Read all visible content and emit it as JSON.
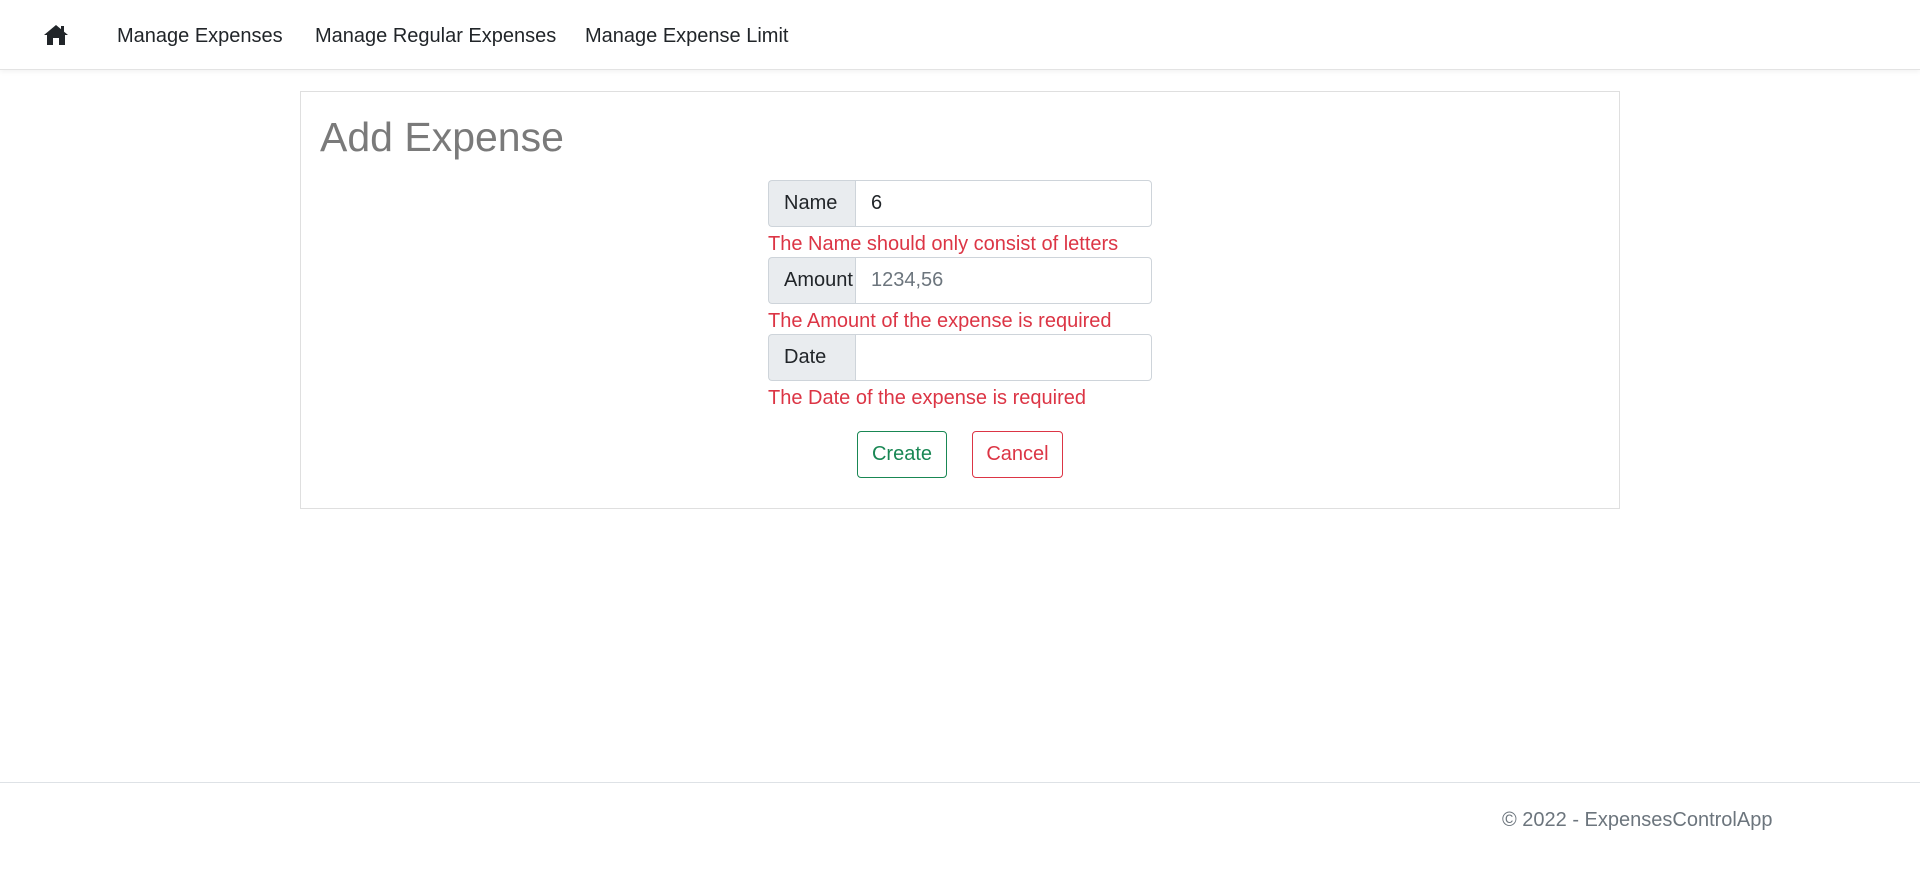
{
  "nav": {
    "home_icon": "home-icon",
    "links": [
      {
        "label": "Manage Expenses"
      },
      {
        "label": "Manage Regular Expenses"
      },
      {
        "label": "Manage Expense Limit"
      }
    ]
  },
  "form": {
    "title": "Add Expense",
    "fields": {
      "name": {
        "label": "Name",
        "value": "6",
        "placeholder": "",
        "error": "The Name should only consist of letters"
      },
      "amount": {
        "label": "Amount",
        "value": "",
        "placeholder": "1234,56",
        "error": "The Amount of the expense is required"
      },
      "date": {
        "label": "Date",
        "value": "",
        "placeholder": "",
        "error": "The Date of the expense is required"
      }
    },
    "buttons": {
      "create": "Create",
      "cancel": "Cancel"
    }
  },
  "footer": {
    "text": "© 2022 - ExpensesControlApp"
  },
  "colors": {
    "error": "#dc3545",
    "success": "#198754",
    "title": "#7a7a7a"
  }
}
